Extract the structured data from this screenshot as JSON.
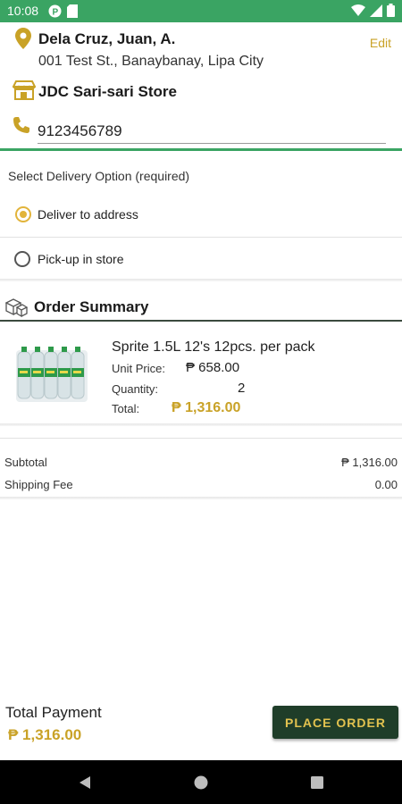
{
  "status_bar": {
    "time": "10:08"
  },
  "customer": {
    "name": "Dela Cruz, Juan, A.",
    "address": "001 Test St., Banaybanay, Lipa City",
    "store": "JDC Sari-sari Store",
    "phone": "9123456789",
    "edit_label": "Edit"
  },
  "delivery": {
    "label": "Select Delivery Option (required)",
    "options": [
      {
        "label": "Deliver to address",
        "selected": true
      },
      {
        "label": "Pick-up in store",
        "selected": false
      }
    ]
  },
  "order_summary": {
    "title": "Order Summary",
    "item": {
      "name": "Sprite 1.5L 12's  12pcs. per pack",
      "unit_price_label": "Unit Price:",
      "unit_price": "₱ 658.00",
      "quantity_label": "Quantity:",
      "quantity": "2",
      "total_label": "Total:",
      "total": "₱ 1,316.00"
    }
  },
  "summary": {
    "subtotal_label": "Subtotal",
    "subtotal": "₱ 1,316.00",
    "shipping_label": "Shipping Fee",
    "shipping": "0.00"
  },
  "footer": {
    "total_payment_label": "Total Payment",
    "total_payment": "₱ 1,316.00",
    "place_order_label": "PLACE ORDER"
  },
  "colors": {
    "status_green": "#3aa463",
    "accent_gold": "#c9a227",
    "button_dark_green": "#1f3d29"
  }
}
